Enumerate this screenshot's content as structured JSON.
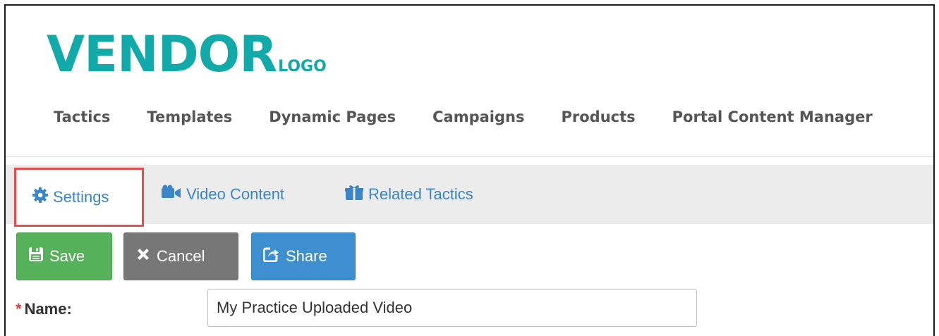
{
  "logo": {
    "main": "VENDOR",
    "sub": "LOGO"
  },
  "topnav": {
    "items": [
      {
        "label": "Tactics"
      },
      {
        "label": "Templates"
      },
      {
        "label": "Dynamic Pages"
      },
      {
        "label": "Campaigns"
      },
      {
        "label": "Products"
      },
      {
        "label": "Portal Content Manager"
      }
    ]
  },
  "tabs": {
    "settings": {
      "label": "Settings",
      "icon": "gear-icon"
    },
    "video": {
      "label": "Video Content",
      "icon": "video-camera-icon"
    },
    "related": {
      "label": "Related Tactics",
      "icon": "gift-icon"
    }
  },
  "toolbar": {
    "save_label": "Save",
    "cancel_label": "Cancel",
    "share_label": "Share"
  },
  "form": {
    "required_marker": "*",
    "name_label": "Name:",
    "name_value": "My Practice Uploaded Video"
  },
  "colors": {
    "logo": "#12aaa9",
    "link": "#3a86c8",
    "save": "#56b25a",
    "cancel": "#777777",
    "share": "#3e8fd0",
    "highlight": "#e54d4d"
  }
}
